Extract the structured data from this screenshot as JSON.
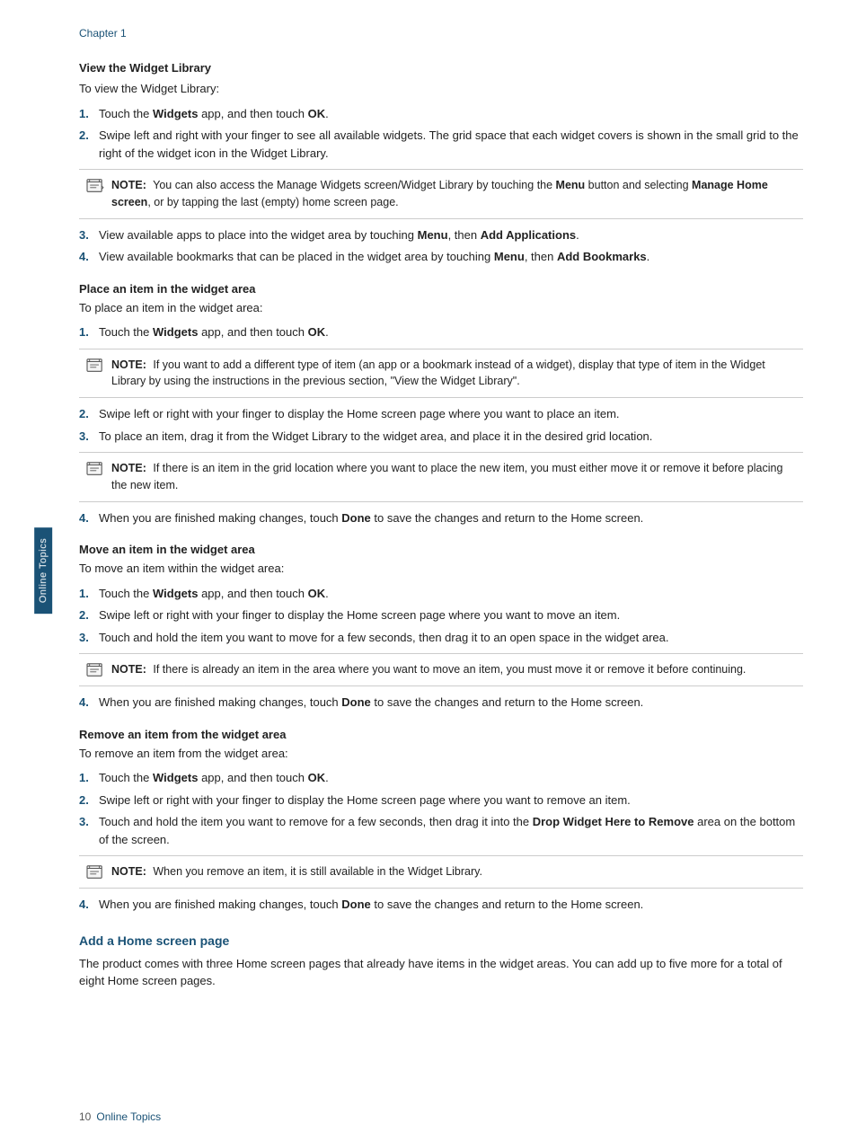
{
  "side_tab": "Online Topics",
  "chapter": "Chapter 1",
  "footer": {
    "page_num": "10",
    "label": "Online Topics"
  },
  "sections": [
    {
      "id": "view-widget-library",
      "heading": "View the Widget Library",
      "heading_type": "bold",
      "intro": "To view the Widget Library:",
      "items": [
        {
          "num": "1.",
          "html": "Touch the <b>Widgets</b> app, and then touch <b>OK</b>."
        },
        {
          "num": "2.",
          "html": "Swipe left and right with your finger to see all available widgets. The grid space that each widget covers is shown in the small grid to the right of the widget icon in the Widget Library."
        }
      ],
      "note": {
        "text": "You can also access the Manage Widgets screen/Widget Library by touching the <b>Menu</b> button and selecting <b>Manage Home screen</b>, or by tapping the last (empty) home screen page."
      },
      "items2": [
        {
          "num": "3.",
          "html": "View available apps to place into the widget area by touching <b>Menu</b>, then <b>Add Applications</b>."
        },
        {
          "num": "4.",
          "html": "View available bookmarks that can be placed in the widget area by touching <b>Menu</b>, then <b>Add Bookmarks</b>."
        }
      ]
    },
    {
      "id": "place-item-widget",
      "heading": "Place an item in the widget area",
      "heading_type": "bold",
      "intro": "To place an item in the widget area:",
      "items": [
        {
          "num": "1.",
          "html": "Touch the <b>Widgets</b> app, and then touch <b>OK</b>."
        }
      ],
      "note": {
        "text": "If you want to add a different type of item (an app or a bookmark instead of a widget), display that type of item in the Widget Library by using the instructions in the previous section, \"View the Widget Library\"."
      },
      "items2": [
        {
          "num": "2.",
          "html": "Swipe left or right with your finger to display the Home screen page where you want to place an item."
        },
        {
          "num": "3.",
          "html": "To place an item, drag it from the Widget Library to the widget area, and place it in the desired grid location."
        }
      ],
      "note2": {
        "text": "If there is an item in the grid location where you want to place the new item, you must either move it or remove it before placing the new item."
      },
      "items3": [
        {
          "num": "4.",
          "html": "When you are finished making changes, touch <b>Done</b> to save the changes and return to the Home screen."
        }
      ]
    },
    {
      "id": "move-item-widget",
      "heading": "Move an item in the widget area",
      "heading_type": "bold",
      "intro": "To move an item within the widget area:",
      "items": [
        {
          "num": "1.",
          "html": "Touch the <b>Widgets</b> app, and then touch <b>OK</b>."
        },
        {
          "num": "2.",
          "html": "Swipe left or right with your finger to display the Home screen page where you want to move an item."
        },
        {
          "num": "3.",
          "html": "Touch and hold the item you want to move for a few seconds, then drag it to an open space in the widget area."
        }
      ],
      "note": {
        "text": "If there is already an item in the area where you want to move an item, you must move it or remove it before continuing."
      },
      "items2": [
        {
          "num": "4.",
          "html": "When you are finished making changes, touch <b>Done</b> to save the changes and return to the Home screen."
        }
      ]
    },
    {
      "id": "remove-item-widget",
      "heading": "Remove an item from the widget area",
      "heading_type": "bold",
      "intro": "To remove an item from the widget area:",
      "items": [
        {
          "num": "1.",
          "html": "Touch the <b>Widgets</b> app, and then touch <b>OK</b>."
        },
        {
          "num": "2.",
          "html": "Swipe left or right with your finger to display the Home screen page where you want to remove an item."
        },
        {
          "num": "3.",
          "html": "Touch and hold the item you want to remove for a few seconds, then drag it into the <b>Drop Widget Here to Remove</b> area on the bottom of the screen."
        }
      ],
      "note": {
        "text": "When you remove an item, it is still available in the Widget Library."
      },
      "items2": [
        {
          "num": "4.",
          "html": "When you are finished making changes, touch <b>Done</b> to save the changes and return to the Home screen."
        }
      ]
    },
    {
      "id": "add-home-screen",
      "heading": "Add a Home screen page",
      "heading_type": "blue",
      "intro": "The product comes with three Home screen pages that already have items in the widget areas. You can add up to five more for a total of eight Home screen pages."
    }
  ]
}
